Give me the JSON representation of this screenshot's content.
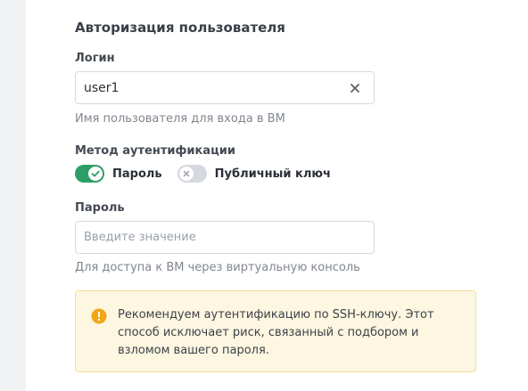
{
  "section": {
    "title": "Авторизация пользователя"
  },
  "login": {
    "label": "Логин",
    "value": "user1",
    "hint": "Имя пользователя для входа в ВМ",
    "clear_icon": "close-icon"
  },
  "auth_method": {
    "label": "Метод аутентификации",
    "options": [
      {
        "label": "Пароль",
        "selected": true,
        "icon": "check-icon"
      },
      {
        "label": "Публичный ключ",
        "selected": false,
        "icon": "close-icon"
      }
    ]
  },
  "password": {
    "label": "Пароль",
    "placeholder": "Введите значение",
    "value": "",
    "hint": "Для доступа к ВМ через виртуальную консоль"
  },
  "alert": {
    "icon": "warning-icon",
    "text": "Рекомендуем аутентификацию по SSH-ключу. Этот способ исключает риск, связанный с подбором и взломом вашего пароля."
  },
  "colors": {
    "toggle_on": "#2e9e68",
    "toggle_off": "#d5d8de",
    "alert_background": "#fdf6e1",
    "alert_border": "#f3df9f",
    "alert_icon": "#f0a617"
  }
}
